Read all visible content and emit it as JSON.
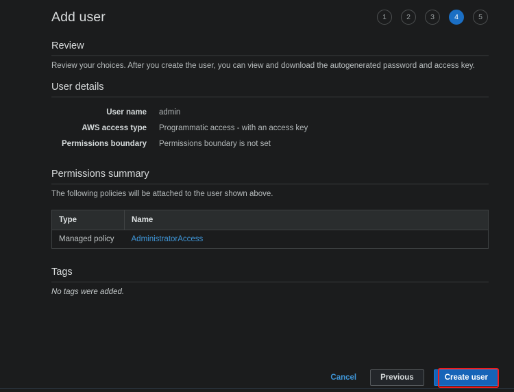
{
  "page": {
    "title": "Add user"
  },
  "stepper": {
    "steps": [
      {
        "label": "1",
        "active": false
      },
      {
        "label": "2",
        "active": false
      },
      {
        "label": "3",
        "active": false
      },
      {
        "label": "4",
        "active": true
      },
      {
        "label": "5",
        "active": false
      }
    ],
    "active_step": "4",
    "active_color": "#1b6fc4"
  },
  "review": {
    "heading": "Review",
    "description": "Review your choices. After you create the user, you can view and download the autogenerated password and access key."
  },
  "user_details": {
    "heading": "User details",
    "rows": [
      {
        "label": "User name",
        "value": "admin"
      },
      {
        "label": "AWS access type",
        "value": "Programmatic access - with an access key"
      },
      {
        "label": "Permissions boundary",
        "value": "Permissions boundary is not set"
      }
    ]
  },
  "permissions_summary": {
    "heading": "Permissions summary",
    "description": "The following policies will be attached to the user shown above.",
    "table": {
      "columns": [
        "Type",
        "Name"
      ],
      "rows": [
        {
          "type": "Managed policy",
          "name": "AdministratorAccess",
          "name_is_link": true
        }
      ]
    }
  },
  "tags": {
    "heading": "Tags",
    "empty_message": "No tags were added."
  },
  "footer": {
    "cancel_label": "Cancel",
    "previous_label": "Previous",
    "create_label": "Create user",
    "highlight_color": "#f01c1c",
    "primary_color": "#1664b8",
    "link_color": "#3f96d8"
  }
}
